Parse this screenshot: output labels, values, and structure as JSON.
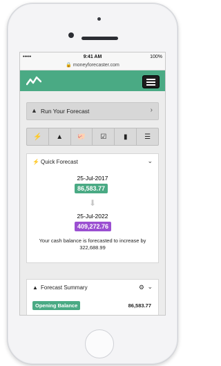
{
  "status_bar": {
    "signal": "•••••",
    "time": "9:41 AM",
    "battery": "100%"
  },
  "url": "moneyforecaster.com",
  "run_forecast": {
    "label": "Run Your Forecast"
  },
  "quick_forecast": {
    "title": "Quick Forecast",
    "start_date": "25-Jul-2017",
    "start_value": "86,583.77",
    "end_date": "25-Jul-2022",
    "end_value": "409,272.76",
    "message": "Your cash balance is forecasted to increase by 322,688.99"
  },
  "forecast_summary": {
    "title": "Forecast Summary",
    "opening_label": "Opening Balance",
    "opening_value": "86,583.77"
  },
  "colors": {
    "brand": "#4aaa84",
    "purple": "#9b4fd1"
  },
  "toolbar_icons": [
    "bolt-icon",
    "road-icon",
    "piggy-bank-icon",
    "check-icon",
    "bar-chart-icon",
    "server-icon"
  ]
}
